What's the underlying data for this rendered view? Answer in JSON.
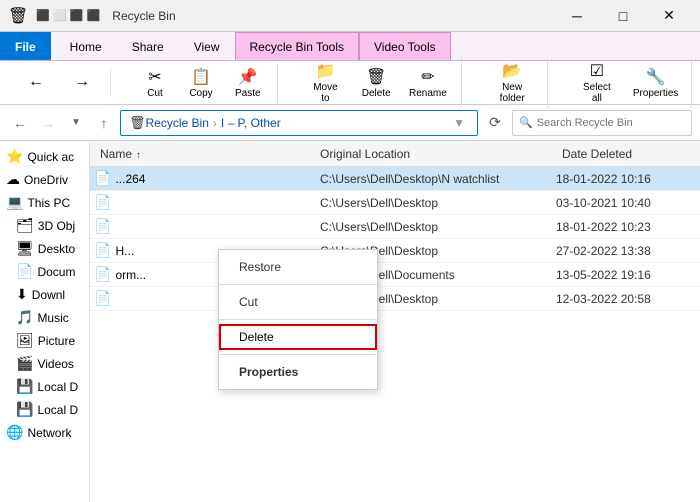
{
  "titleBar": {
    "title": "Recycle Bin",
    "controls": {
      "minimize": "─",
      "maximize": "□",
      "close": "✕"
    }
  },
  "ribbon": {
    "tabs": [
      {
        "id": "file",
        "label": "File",
        "type": "file"
      },
      {
        "id": "home",
        "label": "Home",
        "type": "normal"
      },
      {
        "id": "share",
        "label": "Share",
        "type": "normal"
      },
      {
        "id": "view",
        "label": "View",
        "type": "normal"
      },
      {
        "id": "recycle-bin-tools",
        "label": "Recycle Bin Tools",
        "type": "manage"
      },
      {
        "id": "video-tools",
        "label": "Video Tools",
        "type": "play"
      }
    ]
  },
  "addressBar": {
    "backDisabled": false,
    "forwardDisabled": true,
    "upDisabled": false,
    "path": [
      "Recycle Bin",
      "I – P, Other"
    ],
    "searchPlaceholder": "Search Recycle Bin"
  },
  "sidebar": {
    "items": [
      {
        "id": "quick-access",
        "label": "Quick ac",
        "icon": "quick"
      },
      {
        "id": "onedrive",
        "label": "OneDriv",
        "icon": "folder"
      },
      {
        "id": "this-pc",
        "label": "This PC",
        "icon": "pc"
      },
      {
        "id": "3d-objects",
        "label": "3D Obj",
        "icon": "3d"
      },
      {
        "id": "desktop",
        "label": "Deskto",
        "icon": "desktop"
      },
      {
        "id": "documents",
        "label": "Docum",
        "icon": "docs"
      },
      {
        "id": "downloads",
        "label": "Downl",
        "icon": "dl"
      },
      {
        "id": "music",
        "label": "Music",
        "icon": "music"
      },
      {
        "id": "pictures",
        "label": "Picture",
        "icon": "pics"
      },
      {
        "id": "videos",
        "label": "Videos",
        "icon": "vids"
      },
      {
        "id": "local-c",
        "label": "Local D",
        "icon": "drive"
      },
      {
        "id": "local-d",
        "label": "Local D",
        "icon": "drive"
      },
      {
        "id": "network",
        "label": "Network",
        "icon": "network"
      }
    ]
  },
  "fileList": {
    "columns": [
      {
        "id": "name",
        "label": "Name"
      },
      {
        "id": "location",
        "label": "Original Location"
      },
      {
        "id": "date",
        "label": "Date Deleted"
      }
    ],
    "rows": [
      {
        "id": 1,
        "name": "..264",
        "icon": "pdf",
        "location": "C:\\Users\\Dell\\Desktop\\N watchlist",
        "date": "18-01-2022 10:16",
        "selected": true
      },
      {
        "id": 2,
        "name": "",
        "icon": "pdf",
        "location": "C:\\Users\\Dell\\Desktop",
        "date": "03-10-2021 10:40",
        "selected": false
      },
      {
        "id": 3,
        "name": "",
        "icon": "pdf",
        "location": "C:\\Users\\Dell\\Desktop",
        "date": "18-01-2022 10:23",
        "selected": false
      },
      {
        "id": 4,
        "name": "H...",
        "icon": "pdf",
        "location": "C:\\Users\\Dell\\Desktop",
        "date": "27-02-2022 13:38",
        "selected": false
      },
      {
        "id": 5,
        "name": "orm...",
        "icon": "pdf",
        "location": "C:\\Users\\Dell\\Documents",
        "date": "13-05-2022 19:16",
        "selected": false
      },
      {
        "id": 6,
        "name": "",
        "icon": "pdf",
        "location": "C:\\Users\\Dell\\Desktop",
        "date": "12-03-2022 20:58",
        "selected": false
      }
    ]
  },
  "contextMenu": {
    "items": [
      {
        "id": "restore",
        "label": "Restore",
        "type": "normal"
      },
      {
        "id": "separator1",
        "type": "separator"
      },
      {
        "id": "cut",
        "label": "Cut",
        "type": "normal"
      },
      {
        "id": "separator2",
        "type": "separator"
      },
      {
        "id": "delete",
        "label": "Delete",
        "type": "delete"
      },
      {
        "id": "separator3",
        "type": "separator"
      },
      {
        "id": "properties",
        "label": "Properties",
        "type": "normal"
      }
    ]
  }
}
